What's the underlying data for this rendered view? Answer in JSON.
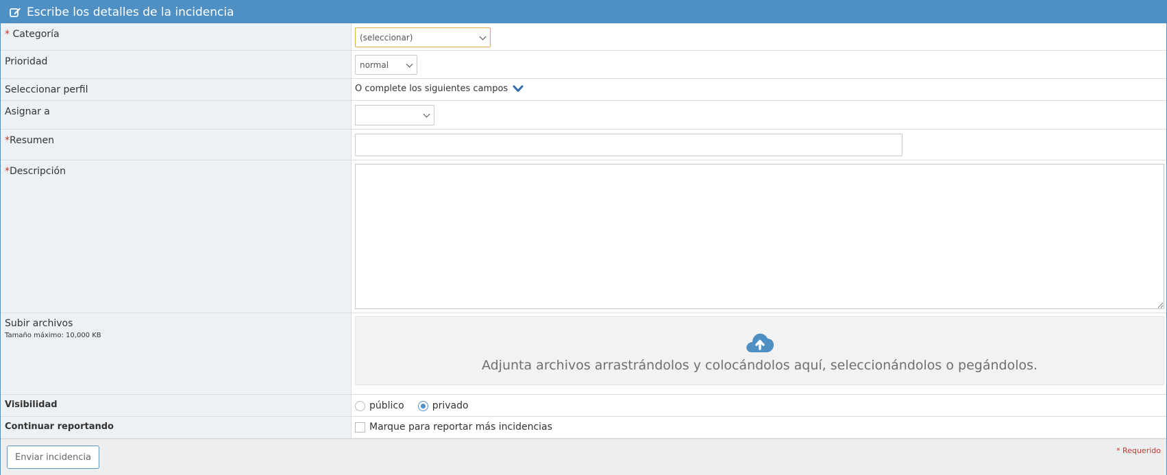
{
  "header": {
    "title": "Escribe los detalles de la incidencia",
    "icon": "edit-icon"
  },
  "fields": {
    "category": {
      "required_mark": "*",
      "label": "Categoría",
      "selected": "(seleccionar)"
    },
    "priority": {
      "label": "Prioridad",
      "selected": "normal"
    },
    "profile": {
      "label": "Seleccionar perfil",
      "alt_text": "O complete los siguientes campos",
      "icon": "chevron-down-icon"
    },
    "assign": {
      "label": "Asignar a",
      "selected": ""
    },
    "summary": {
      "required_mark": "*",
      "label": "Resumen",
      "value": ""
    },
    "description": {
      "required_mark": "*",
      "label": "Descripción",
      "value": ""
    },
    "upload": {
      "label": "Subir archivos",
      "max_size": "Tamaño máximo: 10,000 KB",
      "dropzone_text": "Adjunta archivos arrastrándolos y colocándolos aquí, seleccionándolos o pegándolos.",
      "icon": "cloud-upload-icon"
    },
    "visibility": {
      "label": "Visibilidad",
      "options": [
        {
          "label": "público",
          "checked": false
        },
        {
          "label": "privado",
          "checked": true
        }
      ]
    },
    "continue_reporting": {
      "label": "Continuar reportando",
      "checkbox_label": "Marque para reportar más incidencias",
      "checked": false
    }
  },
  "footer": {
    "submit_label": "Enviar incidencia",
    "required_note": "* Requerido"
  },
  "colors": {
    "accent": "#4e8fc4",
    "required": "#c0392b",
    "label_bg": "#edf1f4",
    "category_border": "#e8a84a"
  }
}
